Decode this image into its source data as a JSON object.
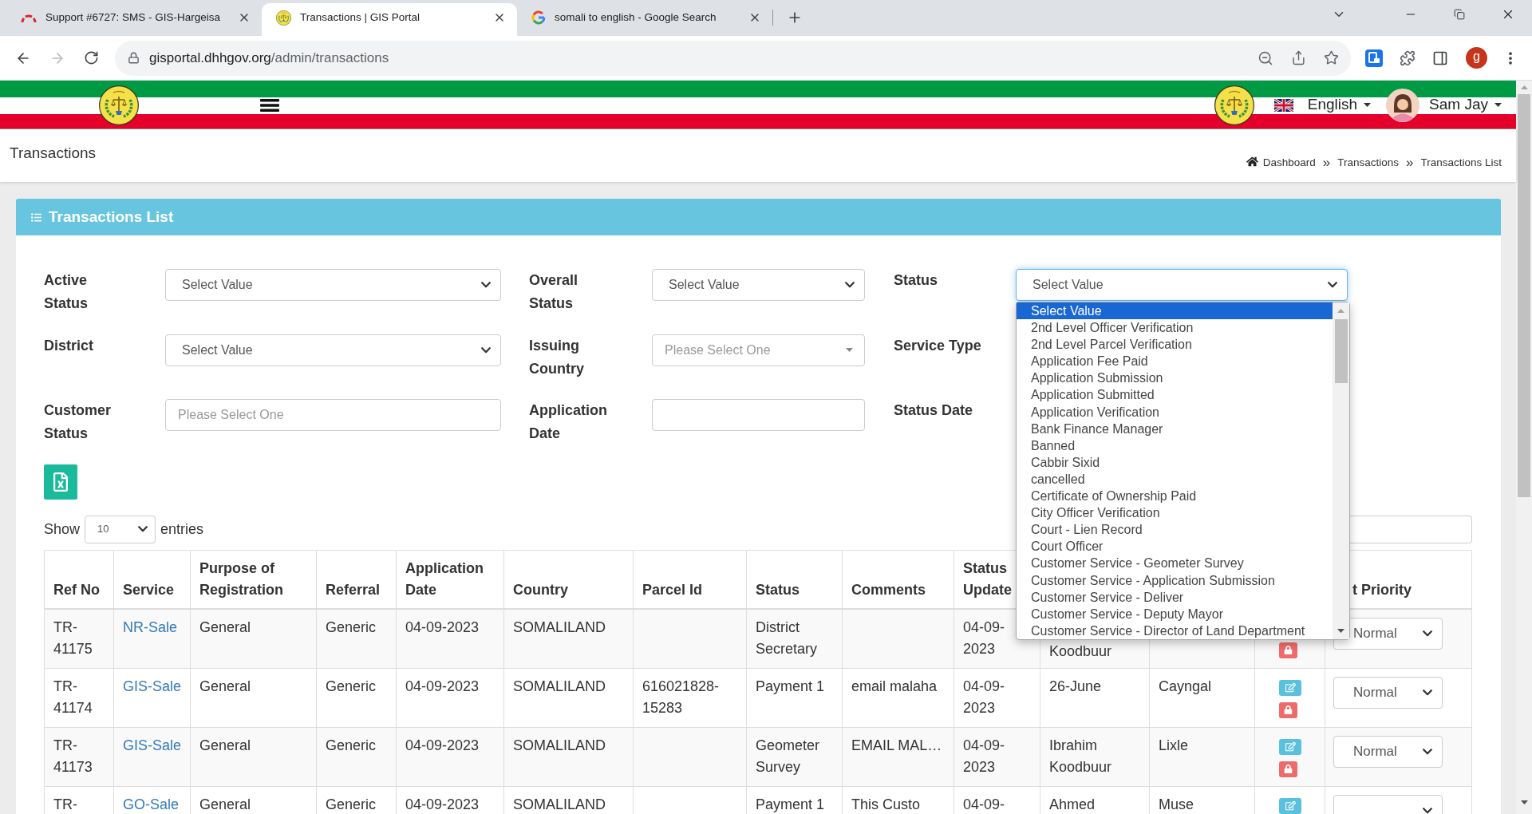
{
  "browser": {
    "tabs": [
      {
        "title": "Support #6727: SMS - GIS-Hargeisa",
        "kind": "arcs",
        "selected": false
      },
      {
        "title": "Transactions | GIS Portal",
        "kind": "emblem",
        "selected": true
      },
      {
        "title": "somali to english - Google Search",
        "kind": "ring",
        "selected": false
      }
    ],
    "address": {
      "host": "gisportal.dhhgov.org",
      "path": "/admin/transactions"
    },
    "profile_initial": "g"
  },
  "navbar": {
    "language": "English",
    "user": "Sam Jay"
  },
  "page_header": {
    "title": "Transactions",
    "breadcrumb": [
      "Dashboard",
      "Transactions",
      "Transactions List"
    ],
    "separators": [
      "»",
      "»"
    ]
  },
  "card": {
    "title": "Transactions List"
  },
  "filters": [
    [
      {
        "label": "Active Status",
        "kind": "select",
        "value": "Select Value",
        "focused": false,
        "open": false
      },
      {
        "label": "Overall Status",
        "kind": "select",
        "value": "Select Value",
        "focused": false,
        "open": false
      },
      {
        "label": "Status",
        "kind": "select",
        "value": "Select Value",
        "focused": true,
        "open": true,
        "options": [
          {
            "label": "Select Value",
            "selected": true
          },
          {
            "label": "2nd Level Officer Verification",
            "selected": false
          },
          {
            "label": "2nd Level Parcel Verification",
            "selected": false
          },
          {
            "label": "Application Fee Paid",
            "selected": false
          },
          {
            "label": "Application Submission",
            "selected": false
          },
          {
            "label": "Application Submitted",
            "selected": false
          },
          {
            "label": "Application Verification",
            "selected": false
          },
          {
            "label": "Bank Finance Manager",
            "selected": false
          },
          {
            "label": "Banned",
            "selected": false
          },
          {
            "label": "Cabbir Sixid",
            "selected": false
          },
          {
            "label": "cancelled",
            "selected": false
          },
          {
            "label": "Certificate of Ownership Paid",
            "selected": false
          },
          {
            "label": "City Officer Verification",
            "selected": false
          },
          {
            "label": "Court - Lien Record",
            "selected": false
          },
          {
            "label": "Court Officer",
            "selected": false
          },
          {
            "label": "Customer Service - Geometer Survey",
            "selected": false
          },
          {
            "label": "Customer Service - Application Submission",
            "selected": false
          },
          {
            "label": "Customer Service - Deliver",
            "selected": false
          },
          {
            "label": "Customer Service - Deputy Mayor",
            "selected": false
          },
          {
            "label": "Customer Service - Director of Land Department",
            "selected": false
          }
        ]
      }
    ],
    [
      {
        "label": "District",
        "kind": "select",
        "value": "Select Value",
        "focused": false,
        "open": false
      },
      {
        "label": "Issuing Country",
        "kind": "combo",
        "placeholder": "Please Select One",
        "focused": false
      },
      {
        "label": "Service Type"
      }
    ],
    [
      {
        "label": "Customer Status",
        "kind": "input",
        "placeholder": "Please Select One",
        "focused": false
      },
      {
        "label": "Application Date",
        "kind": "input",
        "focused": false
      },
      {
        "label": "Status Date"
      }
    ]
  ],
  "length_menu": {
    "prefix": "Show",
    "value": "10",
    "suffix": "entries"
  },
  "table": {
    "header": {
      "ref_no": "Ref No",
      "service": "Service",
      "purpose": "Purpose of Registration",
      "referral": "Referral",
      "application_date": "Application Date",
      "country": "Country",
      "parcel_id": "Parcel Id",
      "status": "Status",
      "comments": "Comments",
      "status_updated": "Status Update",
      "priority": "t Priority"
    },
    "rows": [
      {
        "ref_no": "TR-41175",
        "service": "NR-Sale",
        "purpose": "General",
        "referral": "Generic",
        "application_date": "04-09-2023",
        "country": "SOMALILAND",
        "status": "District Secretary",
        "status_updated": "04-09-2023",
        "column_11": "Koodbuur",
        "actions": [
          {
            "kind": "lock"
          }
        ],
        "priority": "Normal",
        "partly_covered": true
      },
      {
        "ref_no": "TR-41174",
        "service": "GIS-Sale",
        "purpose": "General",
        "referral": "Generic",
        "application_date": "04-09-2023",
        "country": "SOMALILAND",
        "parcel_id": "616021828-15283",
        "status": "Payment 1",
        "comments": "email malaha",
        "status_updated": "04-09-2023",
        "column_11": "26-June",
        "column_12": "Cayngal",
        "actions": [
          {
            "kind": "edit"
          },
          {
            "kind": "lock"
          }
        ],
        "priority": "Normal",
        "partly_covered": false
      },
      {
        "ref_no": "TR-41173",
        "service": "GIS-Sale",
        "purpose": "General",
        "referral": "Generic",
        "application_date": "04-09-2023",
        "country": "SOMALILAND",
        "status": "Geometer Survey",
        "comments": "EMAIL MAL…",
        "status_updated": "04-09-2023",
        "column_11": "Ibrahim Koodbuur",
        "column_12": "Lixle",
        "actions": [
          {
            "kind": "edit"
          },
          {
            "kind": "lock"
          }
        ],
        "priority": "Normal",
        "partly_covered": false
      },
      {
        "ref_no": "TR-",
        "service": "GO-Sale",
        "purpose": "General",
        "referral": "Generic",
        "application_date": "04-09-2023",
        "country": "SOMALILAND",
        "status": "Payment 1",
        "comments": "This Custo",
        "status_updated": "04-09-",
        "column_11": "Ahmed",
        "column_12": "Muse",
        "actions": [
          {
            "kind": "edit"
          }
        ],
        "partly_covered": false
      }
    ]
  }
}
